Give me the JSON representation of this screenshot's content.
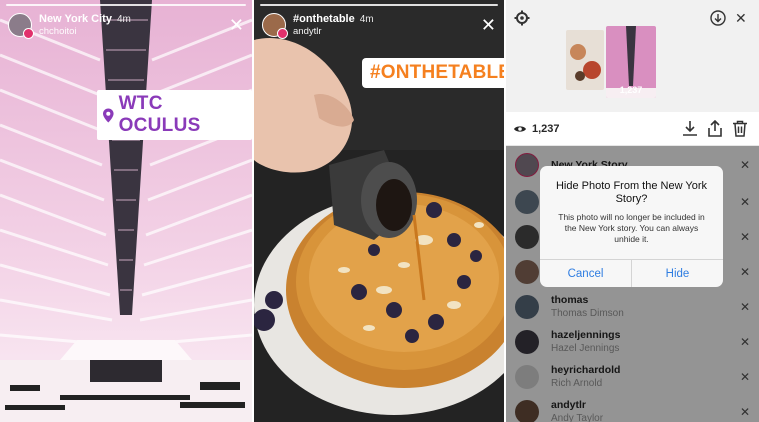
{
  "story1": {
    "location": "New York City",
    "time": "4m",
    "username": "chchoitoi",
    "sticker": "WTC OCULUS"
  },
  "story2": {
    "hashtag": "#onthetable",
    "time": "4m",
    "username": "andytlr",
    "sticker": "#ONTHETABLE"
  },
  "viewers_screen": {
    "view_count": "1,237",
    "thumb_view_count": "1,237",
    "story_item": {
      "name": "New York Story"
    },
    "viewers": [
      {
        "username": "thomas",
        "full_name": "Thomas Dimson",
        "avatar_color": "#5a6b7d"
      },
      {
        "username": "hazeljennings",
        "full_name": "Hazel Jennings",
        "avatar_color": "#3d3a44"
      },
      {
        "username": "heyrichardold",
        "full_name": "Rich Arnold",
        "avatar_color": "#d8d8d8"
      },
      {
        "username": "andytlr",
        "full_name": "Andy Taylor",
        "avatar_color": "#6b4e3d"
      }
    ],
    "dialog": {
      "title": "Hide Photo From the New York Story?",
      "message": "This photo will no longer be included in the New York story. You can always unhide it.",
      "cancel_label": "Cancel",
      "confirm_label": "Hide"
    }
  },
  "colors": {
    "accent_blue": "#2f7de1",
    "location_purple": "#8a3ab9",
    "hashtag_orange": "#f5801f",
    "story_ring": "#e1306c"
  }
}
